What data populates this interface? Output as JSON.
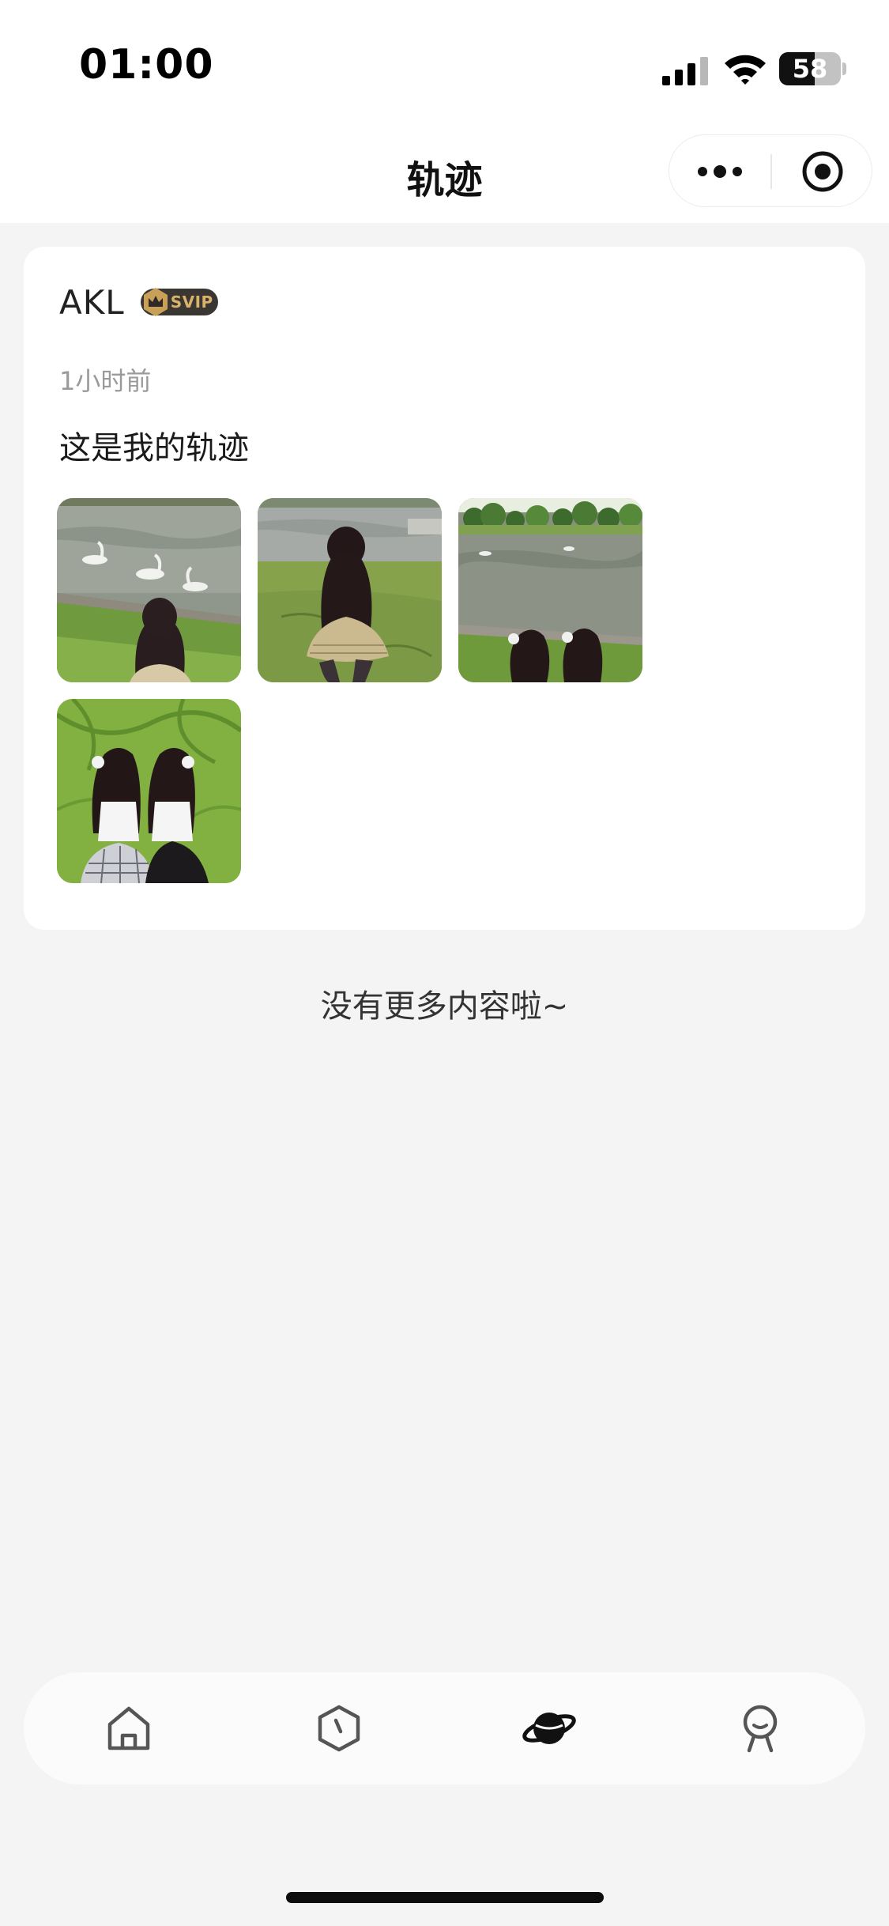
{
  "status_bar": {
    "time": "01:00",
    "battery_level": "58",
    "battery_fraction": 0.58
  },
  "nav": {
    "title": "轨迹",
    "more_icon": "more-dots-icon",
    "close_icon": "target-circle-icon"
  },
  "post": {
    "author": "AKL",
    "badge": "SVIP",
    "time": "1小时前",
    "text": "这是我的轨迹",
    "photos": [
      {
        "name": "photo-girl-swans-pond",
        "icon": "photo"
      },
      {
        "name": "photo-girl-lawn-lake",
        "icon": "photo"
      },
      {
        "name": "photo-two-girls-lake",
        "icon": "photo"
      },
      {
        "name": "photo-two-girls-grass",
        "icon": "photo"
      }
    ]
  },
  "list_end": "没有更多内容啦~",
  "tab_bar": {
    "tabs": [
      {
        "icon": "home-icon",
        "active": false
      },
      {
        "icon": "hexagon-compass-icon",
        "active": false
      },
      {
        "icon": "planet-icon",
        "active": true
      },
      {
        "icon": "profile-icon",
        "active": false
      }
    ]
  },
  "colors": {
    "background": "#f4f4f4",
    "card": "#ffffff",
    "badge_bg": "#3a3632",
    "badge_text": "#d9b36c",
    "secondary_text": "#9a9a9a"
  }
}
